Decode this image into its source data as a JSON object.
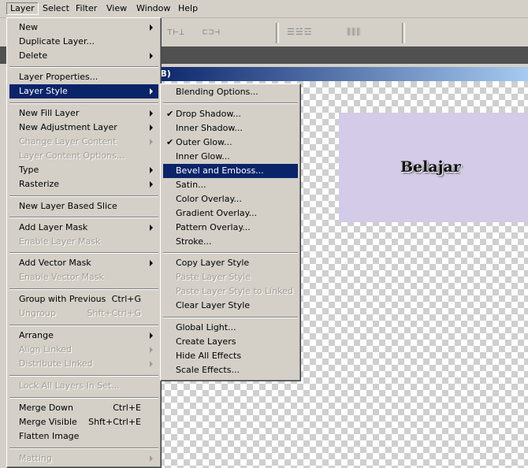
{
  "menubar": [
    "Layer",
    "Select",
    "Filter",
    "View",
    "Window",
    "Help"
  ],
  "document": {
    "title": ":B)"
  },
  "canvas": {
    "layer_text": "Belajar",
    "layer_color": "#d3cbe8"
  },
  "layer_menu": {
    "items": [
      {
        "label": "New",
        "arrow": true
      },
      {
        "label": "Duplicate Layer..."
      },
      {
        "label": "Delete",
        "arrow": true
      },
      {
        "label": "Layer Properties..."
      },
      {
        "label": "Layer Style",
        "arrow": true,
        "highlight": true
      },
      {
        "label": "New Fill Layer",
        "arrow": true
      },
      {
        "label": "New Adjustment Layer",
        "arrow": true
      },
      {
        "label": "Change Layer Content",
        "arrow": true,
        "disabled": true
      },
      {
        "label": "Layer Content Options...",
        "disabled": true
      },
      {
        "label": "Type",
        "arrow": true
      },
      {
        "label": "Rasterize",
        "arrow": true
      },
      {
        "label": "New Layer Based Slice"
      },
      {
        "label": "Add Layer Mask",
        "arrow": true
      },
      {
        "label": "Enable Layer Mask",
        "disabled": true
      },
      {
        "label": "Add Vector Mask",
        "arrow": true
      },
      {
        "label": "Enable Vector Mask",
        "disabled": true
      },
      {
        "label": "Group with Previous",
        "shortcut": "Ctrl+G"
      },
      {
        "label": "Ungroup",
        "shortcut": "Shft+Ctrl+G",
        "disabled": true
      },
      {
        "label": "Arrange",
        "arrow": true
      },
      {
        "label": "Align Linked",
        "arrow": true,
        "disabled": true
      },
      {
        "label": "Distribute Linked",
        "arrow": true,
        "disabled": true
      },
      {
        "label": "Lock All Layers In Set...",
        "disabled": true
      },
      {
        "label": "Merge Down",
        "shortcut": "Ctrl+E"
      },
      {
        "label": "Merge Visible",
        "shortcut": "Shft+Ctrl+E"
      },
      {
        "label": "Flatten Image"
      },
      {
        "label": "Matting",
        "arrow": true,
        "disabled": true
      }
    ]
  },
  "style_menu": {
    "items": [
      {
        "label": "Blending Options..."
      },
      {
        "label": "Drop Shadow...",
        "checked": true
      },
      {
        "label": "Inner Shadow..."
      },
      {
        "label": "Outer Glow...",
        "checked": true
      },
      {
        "label": "Inner Glow..."
      },
      {
        "label": "Bevel and Emboss...",
        "highlight": true
      },
      {
        "label": "Satin..."
      },
      {
        "label": "Color Overlay..."
      },
      {
        "label": "Gradient Overlay..."
      },
      {
        "label": "Pattern Overlay..."
      },
      {
        "label": "Stroke..."
      },
      {
        "label": "Copy Layer Style"
      },
      {
        "label": "Paste Layer Style",
        "disabled": true
      },
      {
        "label": "Paste Layer Style to Linked",
        "disabled": true
      },
      {
        "label": "Clear Layer Style"
      },
      {
        "label": "Global Light..."
      },
      {
        "label": "Create Layers"
      },
      {
        "label": "Hide All Effects"
      },
      {
        "label": "Scale Effects..."
      }
    ]
  },
  "colors": {
    "highlight": "#0a246a",
    "menu_bg": "#d4d0c8",
    "disabled": "#a09c94"
  }
}
